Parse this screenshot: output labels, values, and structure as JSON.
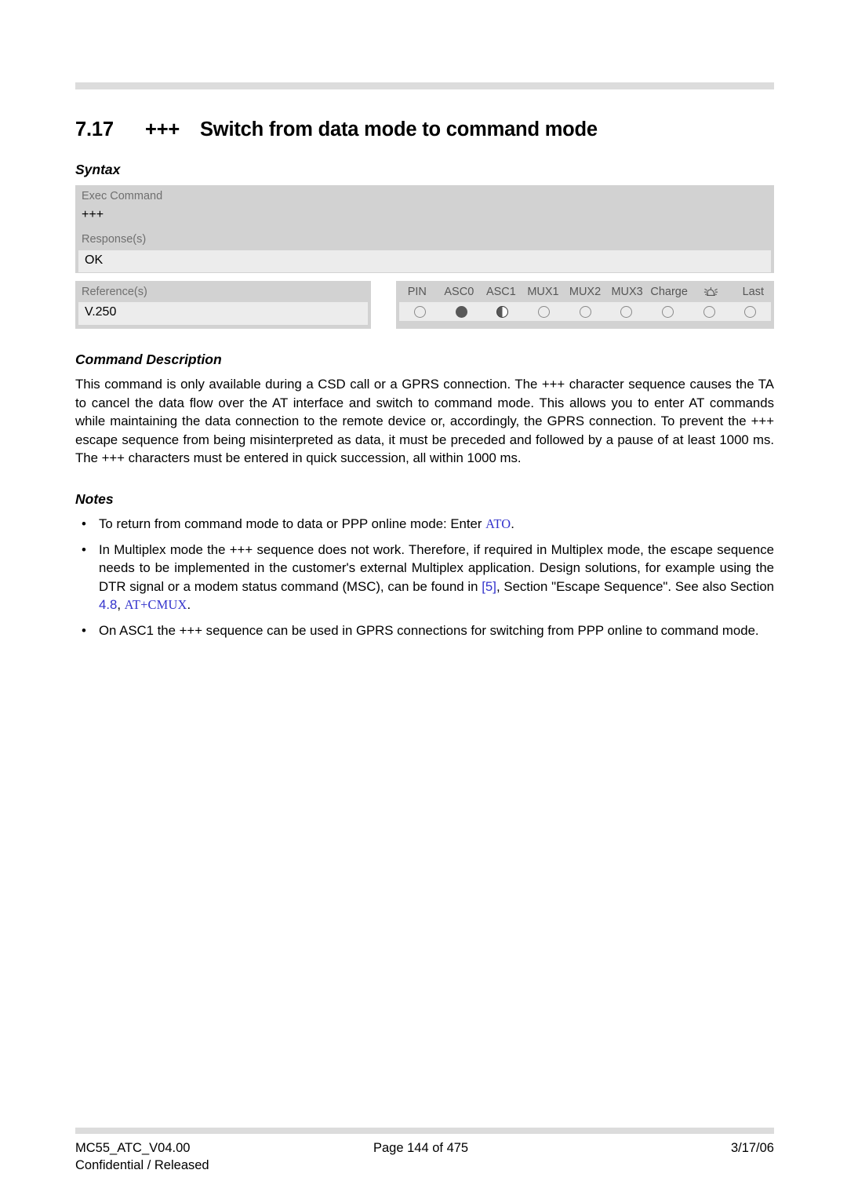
{
  "document": {
    "section_number": "7.17",
    "command": "+++",
    "title": "Switch from data mode to command mode"
  },
  "syntax": {
    "heading": "Syntax",
    "exec_label": "Exec Command",
    "exec_value": "+++",
    "response_label": "Response(s)",
    "response_value": "OK",
    "reference_label": "Reference(s)",
    "reference_value": "V.250",
    "indicators": {
      "columns": [
        {
          "label": "PIN",
          "state": "empty"
        },
        {
          "label": "ASC0",
          "state": "full"
        },
        {
          "label": "ASC1",
          "state": "half"
        },
        {
          "label": "MUX1",
          "state": "empty"
        },
        {
          "label": "MUX2",
          "state": "empty"
        },
        {
          "label": "MUX3",
          "state": "empty"
        },
        {
          "label": "Charge",
          "state": "empty"
        },
        {
          "label": "alarm-icon",
          "state": "empty"
        },
        {
          "label": "Last",
          "state": "empty"
        }
      ]
    }
  },
  "command_description": {
    "heading": "Command Description",
    "paragraph": "This command is only available during a CSD call or a GPRS connection. The +++ character sequence causes the TA to cancel the data flow over the AT interface and switch to command mode. This allows you to enter AT commands while maintaining the data connection to the remote device or, accordingly, the GPRS connection. To prevent the +++ escape sequence from being misinterpreted as data, it must be preceded and followed by a pause of at least 1000 ms. The +++ characters must be entered in quick succession, all within 1000 ms."
  },
  "notes": {
    "heading": "Notes",
    "bullet": "•",
    "items": [
      {
        "text_before": "To return from command mode to data or PPP online mode: Enter ",
        "link": "ATO",
        "link_style": "code",
        "text_after": "."
      },
      {
        "text_before": "In Multiplex mode the +++ sequence does not work. Therefore, if required in Multiplex mode, the escape sequence needs to be implemented in the customer's external Multiplex application. Design solutions, for example using the DTR signal or a modem status command (MSC), can be found in ",
        "link": "[5]",
        "link_style": "plain",
        "text_middle": ", Section \"Escape Sequence\". See also Section ",
        "link2": "4.8",
        "link2_style": "plain",
        "text_middle2": ", ",
        "link3": "AT+CMUX",
        "link3_style": "code",
        "text_after": "."
      },
      {
        "text_before": "On ASC1 the +++ sequence can be used in GPRS connections for switching from PPP online to command mode.",
        "link": "",
        "text_after": ""
      }
    ]
  },
  "footer": {
    "document_id": "MC55_ATC_V04.00",
    "classification": "Confidential / Released",
    "page_info": "Page 144 of 475",
    "date": "3/17/06"
  },
  "colors": {
    "rule": "#dcdcdc",
    "table_header_bg": "#d2d2d2",
    "table_value_bg": "#ececec",
    "label_text": "#6f6f6f",
    "link": "#3333cc",
    "dot_fill": "#585858"
  }
}
